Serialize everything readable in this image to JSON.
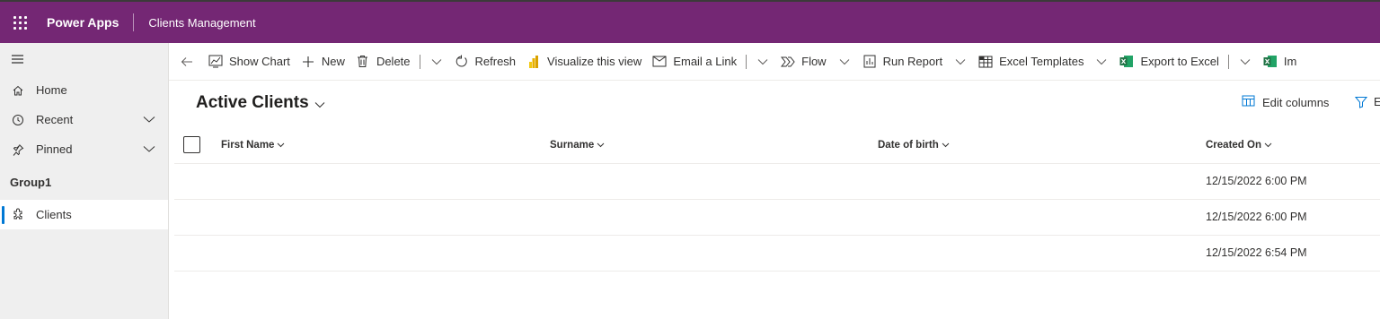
{
  "app": {
    "name": "Power Apps",
    "title": "Clients Management"
  },
  "sidebar": {
    "items": [
      {
        "label": "Home"
      },
      {
        "label": "Recent"
      },
      {
        "label": "Pinned"
      }
    ],
    "group_title": "Group1",
    "group_items": [
      {
        "label": "Clients"
      }
    ]
  },
  "commandbar": {
    "show_chart": "Show Chart",
    "new": "New",
    "delete": "Delete",
    "refresh": "Refresh",
    "visualize": "Visualize this view",
    "email_link": "Email a Link",
    "flow": "Flow",
    "run_report": "Run Report",
    "excel_templates": "Excel Templates",
    "export_excel": "Export to Excel",
    "import_truncated": "Im"
  },
  "view": {
    "title": "Active Clients",
    "edit_columns": "Edit columns",
    "filter_truncated": "E"
  },
  "grid": {
    "columns": [
      "First Name",
      "Surname",
      "Date of birth",
      "Created On"
    ],
    "rows": [
      [
        "",
        "",
        "",
        "12/15/2022 6:00 PM"
      ],
      [
        "",
        "",
        "",
        "12/15/2022 6:00 PM"
      ],
      [
        "",
        "",
        "",
        "12/15/2022 6:54 PM"
      ]
    ]
  },
  "colors": {
    "topbar": "#742774",
    "accent": "#0078d4",
    "excel_green": "#217346"
  }
}
